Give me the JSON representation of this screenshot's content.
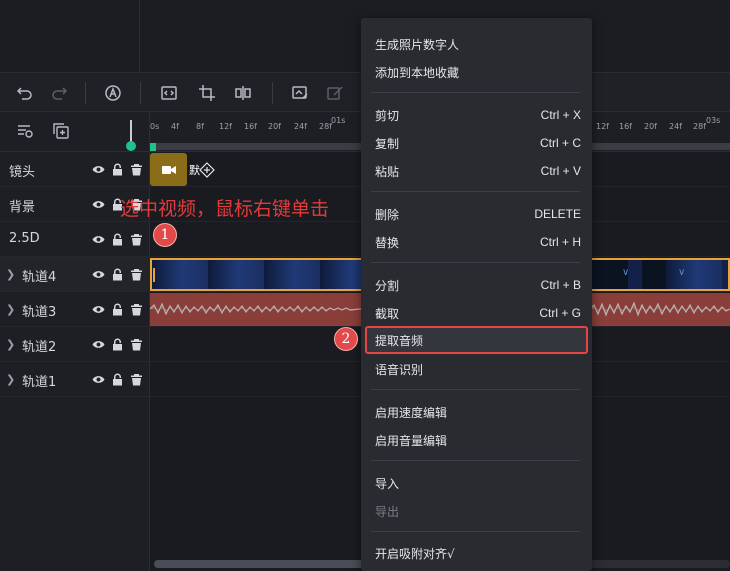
{
  "tracks": [
    {
      "name": "镜头"
    },
    {
      "name": "背景"
    },
    {
      "name": "2.5D"
    },
    {
      "name": "轨道4"
    },
    {
      "name": "轨道3"
    },
    {
      "name": "轨道2"
    },
    {
      "name": "轨道1"
    }
  ],
  "ruler": {
    "ticks": [
      "0s",
      "4f",
      "8f",
      "12f",
      "16f",
      "20f",
      "24f",
      "28f",
      "01s",
      "12f",
      "16f",
      "20f",
      "24f",
      "28f",
      "03s"
    ]
  },
  "lens_clip": {
    "text": "默"
  },
  "annotation": {
    "instruction": "选中视频，鼠标右键单击",
    "step1": "1",
    "step2": "2"
  },
  "context_menu": {
    "items": [
      {
        "label": "生成照片数字人",
        "shortcut": ""
      },
      {
        "label": "添加到本地收藏",
        "shortcut": ""
      },
      {
        "label": "剪切",
        "shortcut": "Ctrl + X"
      },
      {
        "label": "复制",
        "shortcut": "Ctrl + C"
      },
      {
        "label": "粘贴",
        "shortcut": "Ctrl + V"
      },
      {
        "label": "删除",
        "shortcut": "DELETE"
      },
      {
        "label": "替换",
        "shortcut": "Ctrl + H"
      },
      {
        "label": "分割",
        "shortcut": "Ctrl + B"
      },
      {
        "label": "截取",
        "shortcut": "Ctrl + G"
      },
      {
        "label": "提取音频",
        "shortcut": ""
      },
      {
        "label": "语音识别",
        "shortcut": ""
      },
      {
        "label": "启用速度编辑",
        "shortcut": ""
      },
      {
        "label": "启用音量编辑",
        "shortcut": ""
      },
      {
        "label": "导入",
        "shortcut": ""
      },
      {
        "label": "导出",
        "shortcut": ""
      },
      {
        "label": "开启吸附对齐√",
        "shortcut": ""
      }
    ]
  },
  "colors": {
    "accent_green": "#22c08e",
    "selection_orange": "#e8a33a",
    "annotation_red": "#e23b3b",
    "audio_clip": "#8a3e3a",
    "lens_clip": "#8a6c19"
  }
}
